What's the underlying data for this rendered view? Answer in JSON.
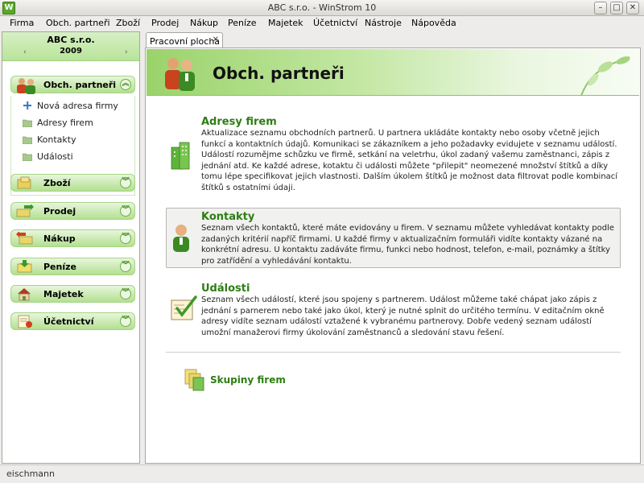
{
  "window": {
    "title": "ABC s.r.o. - WinStrom 10",
    "app_icon_letter": "W",
    "minimize": "–",
    "maximize": "□",
    "close": "✕"
  },
  "menu": [
    {
      "label": "Firma"
    },
    {
      "label": "Obch. partneři"
    },
    {
      "label": "Zboží"
    },
    {
      "label": "Prodej"
    },
    {
      "label": "Nákup"
    },
    {
      "label": "Peníze"
    },
    {
      "label": "Majetek"
    },
    {
      "label": "Účetnictví"
    },
    {
      "label": "Nástroje"
    },
    {
      "label": "Nápověda"
    }
  ],
  "sidebar": {
    "company": "ABC s.r.o.",
    "year": "2009",
    "prev_arrow": "‹",
    "next_arrow": "›",
    "active_section": {
      "label": "Obch. partneři",
      "chevron": "︽",
      "items": [
        {
          "label": "Nová adresa firmy",
          "icon": "plus-icon"
        },
        {
          "label": "Adresy firem",
          "icon": "folder-icon"
        },
        {
          "label": "Kontakty",
          "icon": "folder-icon"
        },
        {
          "label": "Události",
          "icon": "folder-icon"
        }
      ]
    },
    "sections": [
      {
        "label": "Zboží",
        "icon": "goods-icon",
        "chevron": "︾"
      },
      {
        "label": "Prodej",
        "icon": "sales-icon",
        "chevron": "︾"
      },
      {
        "label": "Nákup",
        "icon": "purchase-icon",
        "chevron": "︾"
      },
      {
        "label": "Peníze",
        "icon": "money-icon",
        "chevron": "︾"
      },
      {
        "label": "Majetek",
        "icon": "property-icon",
        "chevron": "︾"
      },
      {
        "label": "Účetnictví",
        "icon": "accounting-icon",
        "chevron": "︾"
      }
    ]
  },
  "tab": {
    "label": "Pracovní plocha",
    "close": "✕"
  },
  "main": {
    "banner_title": "Obch. partneři",
    "items": [
      {
        "title": "Adresy firem",
        "text": "Aktualizace seznamu obchodních partnerů. U partnera ukládáte kontakty nebo osoby včetně jejich funkcí a kontaktních údajů. Komunikaci se zákazníkem a jeho požadavky evidujete v seznamu událostí. Událostí rozumějme schůzku ve firmě, setkání na veletrhu, úkol zadaný vašemu zaměstnanci, zápis z jednání atd. Ke každé adrese, kotaktu či události můžete \"přilepit\" neomezené množství štítků a díky tomu lépe specifikovat jejich vlastnosti. Dalším úkolem štítků je možnost data filtrovat podle kombinací štítků s ostatními údaji."
      },
      {
        "title": "Kontakty",
        "text": "Seznam všech kontaktů, které máte evidovány u firem. V seznamu můžete vyhledávat kontakty podle zadaných kritérií napříč firmami. U každé firmy v aktualizačním formuláři vidíte kontakty vázané na konkrétní adresu. U kontaktu zadáváte firmu, funkci nebo hodnost, telefon, e-mail, poznámky a štítky pro zatřídění a vyhledávání kontaktu."
      },
      {
        "title": "Události",
        "text": "Seznam všech událostí, které jsou spojeny s partnerem. Událost můžeme také chápat jako zápis z jednání s parnerem nebo také jako úkol, který je nutné splnit do určitého termínu. V editačním okně adresy vidíte seznam událostí vztažené k vybranému partnerovy. Dobře vedený seznam událostí umožní manažerovi firmy úkolování zaměstnanců a sledování stavu řešení."
      }
    ],
    "link": "Skupiny firem"
  },
  "status": {
    "user": "eischmann"
  },
  "colors": {
    "accent_green": "#2e7d14",
    "section_green": "#b3e090"
  }
}
